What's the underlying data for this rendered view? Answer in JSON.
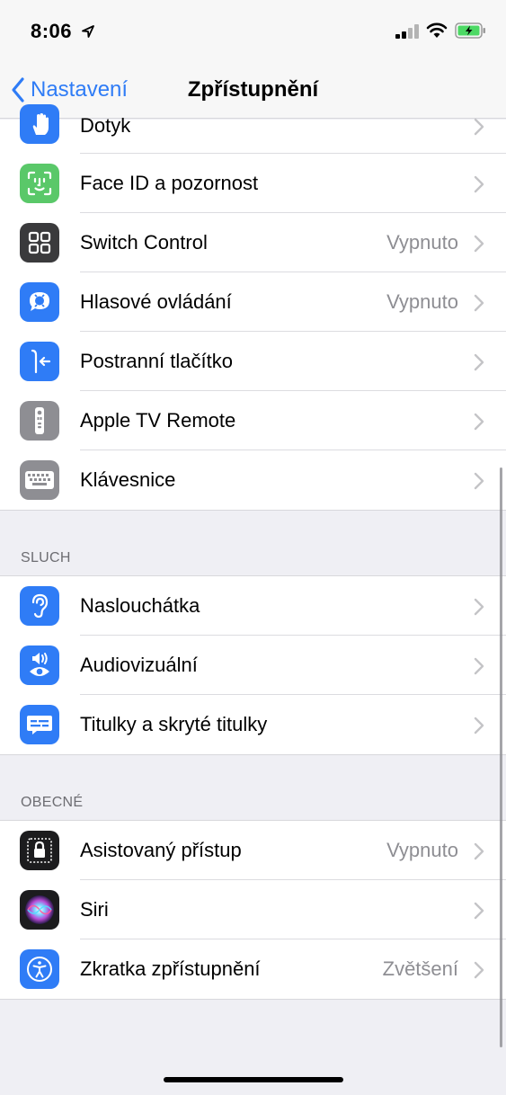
{
  "status": {
    "time": "8:06"
  },
  "nav": {
    "back_label": "Nastavení",
    "title": "Zpřístupnění"
  },
  "group1": {
    "items": [
      {
        "label": "Dotyk",
        "value": "",
        "icon": "hand-icon",
        "color": "#2f7cf6"
      },
      {
        "label": "Face ID a pozornost",
        "value": "",
        "icon": "face-id-icon",
        "color": "#5ac869"
      },
      {
        "label": "Switch Control",
        "value": "Vypnuto",
        "icon": "switch-control-icon",
        "color": "#3a3a3c"
      },
      {
        "label": "Hlasové ovládání",
        "value": "Vypnuto",
        "icon": "voice-control-icon",
        "color": "#2f7cf6"
      },
      {
        "label": "Postranní tlačítko",
        "value": "",
        "icon": "side-button-icon",
        "color": "#2f7cf6"
      },
      {
        "label": "Apple TV Remote",
        "value": "",
        "icon": "tv-remote-icon",
        "color": "#8e8e93"
      },
      {
        "label": "Klávesnice",
        "value": "",
        "icon": "keyboard-icon",
        "color": "#8e8e93"
      }
    ]
  },
  "section_sluch": {
    "header": "SLUCH",
    "items": [
      {
        "label": "Naslouchátka",
        "value": "",
        "icon": "ear-icon",
        "color": "#2f7cf6"
      },
      {
        "label": "Audiovizuální",
        "value": "",
        "icon": "audiovisual-icon",
        "color": "#2f7cf6"
      },
      {
        "label": "Titulky a skryté titulky",
        "value": "",
        "icon": "subtitles-icon",
        "color": "#2f7cf6"
      }
    ]
  },
  "section_obecne": {
    "header": "OBECNÉ",
    "items": [
      {
        "label": "Asistovaný přístup",
        "value": "Vypnuto",
        "icon": "lock-icon",
        "color": "#1c1c1e"
      },
      {
        "label": "Siri",
        "value": "",
        "icon": "siri-icon",
        "color": "#1c1c1e"
      },
      {
        "label": "Zkratka zpřístupnění",
        "value": "Zvětšení",
        "icon": "accessibility-icon",
        "color": "#2f7cf6"
      }
    ]
  }
}
